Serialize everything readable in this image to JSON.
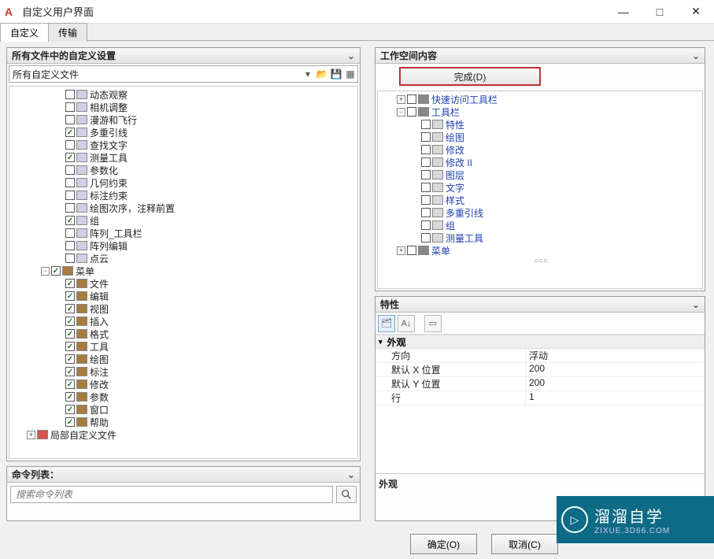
{
  "window": {
    "title": "自定义用户界面"
  },
  "tabs": {
    "active": "自定义",
    "inactive": "传输"
  },
  "left_panel": {
    "title": "所有文件中的自定义设置",
    "file_select": "所有自定义文件",
    "tree": [
      {
        "d": 3,
        "cb": false,
        "lbl": "动态观察"
      },
      {
        "d": 3,
        "cb": false,
        "lbl": "相机调整"
      },
      {
        "d": 3,
        "cb": false,
        "lbl": "漫游和飞行"
      },
      {
        "d": 3,
        "cb": true,
        "lbl": "多重引线"
      },
      {
        "d": 3,
        "cb": false,
        "lbl": "查找文字"
      },
      {
        "d": 3,
        "cb": true,
        "lbl": "测量工具"
      },
      {
        "d": 3,
        "cb": false,
        "lbl": "参数化"
      },
      {
        "d": 3,
        "cb": false,
        "lbl": "几何约束"
      },
      {
        "d": 3,
        "cb": false,
        "lbl": "标注约束"
      },
      {
        "d": 3,
        "cb": false,
        "lbl": "绘图次序，注释前置"
      },
      {
        "d": 3,
        "cb": true,
        "lbl": "组"
      },
      {
        "d": 3,
        "cb": false,
        "lbl": "阵列_工具栏"
      },
      {
        "d": 3,
        "cb": false,
        "lbl": "阵列编辑"
      },
      {
        "d": 3,
        "cb": false,
        "lbl": "点云"
      },
      {
        "d": 2,
        "cb": true,
        "lbl": "菜单",
        "exp": "-",
        "ic": "book"
      },
      {
        "d": 3,
        "cb": true,
        "lbl": "文件",
        "ic": "book"
      },
      {
        "d": 3,
        "cb": true,
        "lbl": "编辑",
        "ic": "book"
      },
      {
        "d": 3,
        "cb": true,
        "lbl": "视图",
        "ic": "book"
      },
      {
        "d": 3,
        "cb": true,
        "lbl": "插入",
        "ic": "book"
      },
      {
        "d": 3,
        "cb": true,
        "lbl": "格式",
        "ic": "book"
      },
      {
        "d": 3,
        "cb": true,
        "lbl": "工具",
        "ic": "book"
      },
      {
        "d": 3,
        "cb": true,
        "lbl": "绘图",
        "ic": "book"
      },
      {
        "d": 3,
        "cb": true,
        "lbl": "标注",
        "ic": "book"
      },
      {
        "d": 3,
        "cb": true,
        "lbl": "修改",
        "ic": "book"
      },
      {
        "d": 3,
        "cb": true,
        "lbl": "参数",
        "ic": "book"
      },
      {
        "d": 3,
        "cb": true,
        "lbl": "窗口",
        "ic": "book"
      },
      {
        "d": 3,
        "cb": true,
        "lbl": "帮助",
        "ic": "book"
      },
      {
        "d": 1,
        "cb": null,
        "lbl": "局部自定义文件",
        "exp": "+",
        "ic": "cui"
      }
    ]
  },
  "cmd_panel": {
    "title": "命令列表：",
    "placeholder": "搜索命令列表"
  },
  "ws_panel": {
    "title": "工作空间内容",
    "done_btn": "完成(D)",
    "tree": [
      {
        "d": 1,
        "lbl": "快速访问工具栏",
        "exp": "+",
        "ic": "root",
        "link": true,
        "cb": false
      },
      {
        "d": 1,
        "lbl": "工具栏",
        "exp": "-",
        "ic": "root",
        "link": true,
        "cb": false
      },
      {
        "d": 2,
        "lbl": "特性",
        "ic": "bar",
        "cb": false
      },
      {
        "d": 2,
        "lbl": "绘图",
        "ic": "bar",
        "cb": false
      },
      {
        "d": 2,
        "lbl": "修改",
        "ic": "bar",
        "cb": false
      },
      {
        "d": 2,
        "lbl": "修改 II",
        "ic": "bar",
        "cb": false
      },
      {
        "d": 2,
        "lbl": "图层",
        "ic": "bar",
        "cb": false
      },
      {
        "d": 2,
        "lbl": "文字",
        "ic": "bar",
        "cb": false
      },
      {
        "d": 2,
        "lbl": "样式",
        "ic": "bar",
        "cb": false
      },
      {
        "d": 2,
        "lbl": "多重引线",
        "ic": "bar",
        "cb": false
      },
      {
        "d": 2,
        "lbl": "组",
        "ic": "bar",
        "cb": false
      },
      {
        "d": 2,
        "lbl": "测量工具",
        "ic": "bar",
        "cb": false
      },
      {
        "d": 1,
        "lbl": "菜单",
        "exp": "+",
        "ic": "root",
        "link": true,
        "cb": false
      }
    ]
  },
  "props_panel": {
    "title": "特性",
    "category": "外观",
    "rows": [
      {
        "name": "方向",
        "value": "浮动"
      },
      {
        "name": "默认 X 位置",
        "value": "200"
      },
      {
        "name": "默认 Y 位置",
        "value": "200"
      },
      {
        "name": "行",
        "value": "1"
      }
    ],
    "desc": "外观"
  },
  "buttons": {
    "ok": "确定(O)",
    "cancel": "取消(C)"
  },
  "watermark": {
    "line1": "溜溜自学",
    "line2": "ZIXUE.3D66.COM"
  }
}
